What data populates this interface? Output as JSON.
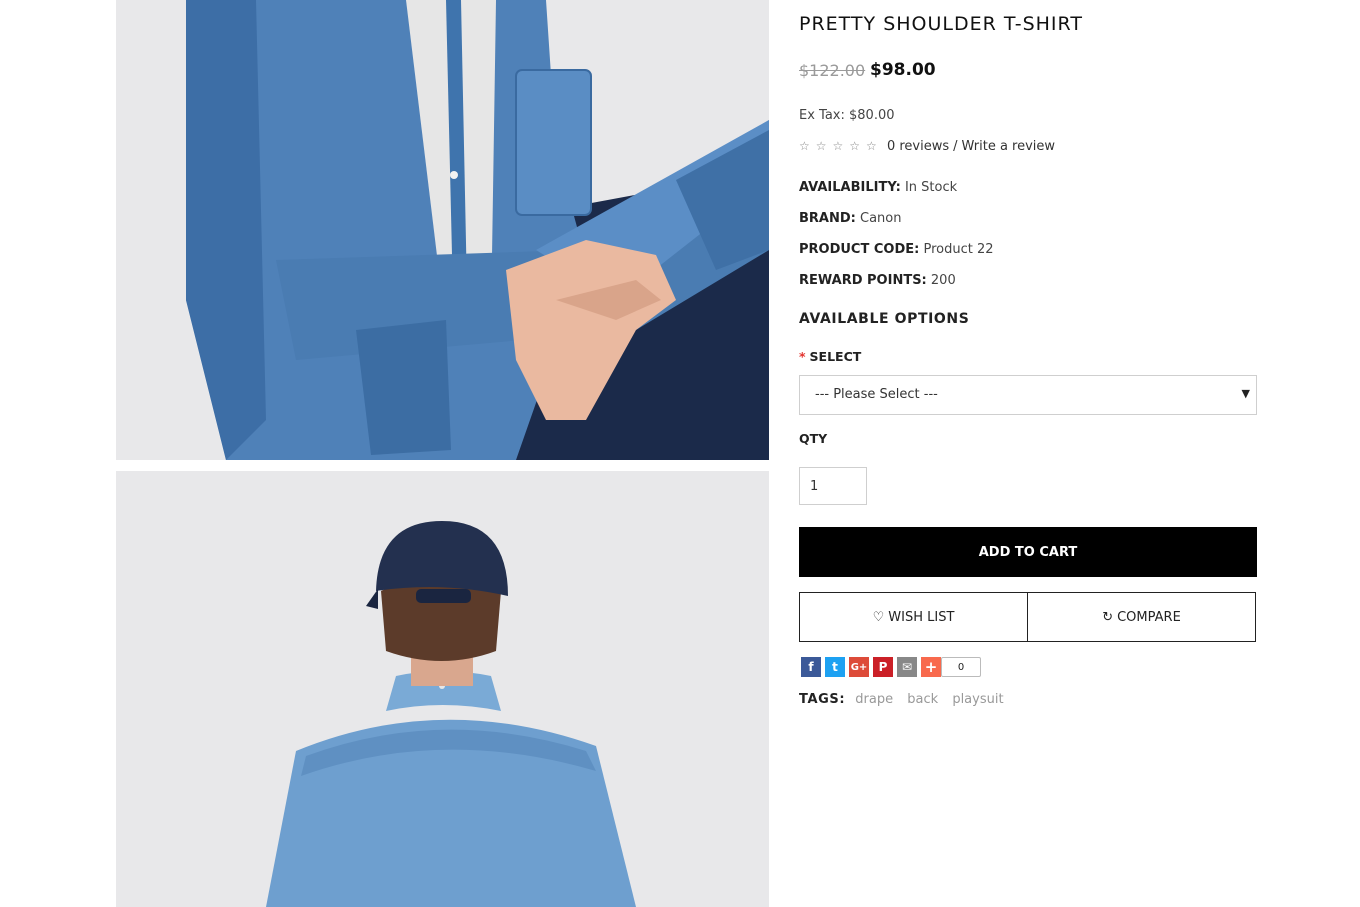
{
  "product": {
    "title": "PRETTY SHOULDER T-SHIRT",
    "old_price": "$122.00",
    "price": "$98.00",
    "ex_tax": "Ex Tax: $80.00",
    "rating_stars": 0,
    "reviews_text": "0 reviews",
    "separator": "/",
    "write_review": "Write a review"
  },
  "specs": [
    {
      "label": "AVAILABILITY:",
      "value": "In Stock"
    },
    {
      "label": "BRAND:",
      "value": "Canon"
    },
    {
      "label": "PRODUCT CODE:",
      "value": "Product 22"
    },
    {
      "label": "REWARD POINTS:",
      "value": "200"
    }
  ],
  "options": {
    "heading": "AVAILABLE OPTIONS",
    "required_mark": "*",
    "select_label": "SELECT",
    "select_value": "--- Please Select ---",
    "qty_label": "QTY",
    "qty_value": "1"
  },
  "actions": {
    "add_to_cart": "ADD TO CART",
    "wish_list": "WISH LIST",
    "compare": "COMPARE"
  },
  "share": {
    "buttons": [
      {
        "icon": "facebook-icon",
        "glyph": "f",
        "color": "#3b5998"
      },
      {
        "icon": "twitter-icon",
        "glyph": "t",
        "color": "#1da1f2"
      },
      {
        "icon": "google-plus-icon",
        "glyph": "G+",
        "color": "#dd4b39"
      },
      {
        "icon": "pinterest-icon",
        "glyph": "P",
        "color": "#cb2027"
      },
      {
        "icon": "email-icon",
        "glyph": "✉",
        "color": "#888888"
      },
      {
        "icon": "addthis-icon",
        "glyph": "+",
        "color": "#f8694d"
      }
    ],
    "count": "0"
  },
  "tags": {
    "label": "TAGS:",
    "items": [
      "drape",
      "back",
      "playsuit"
    ]
  },
  "colors": {
    "primary_button": "#000000",
    "required": "#e3342f",
    "muted": "#999999"
  }
}
